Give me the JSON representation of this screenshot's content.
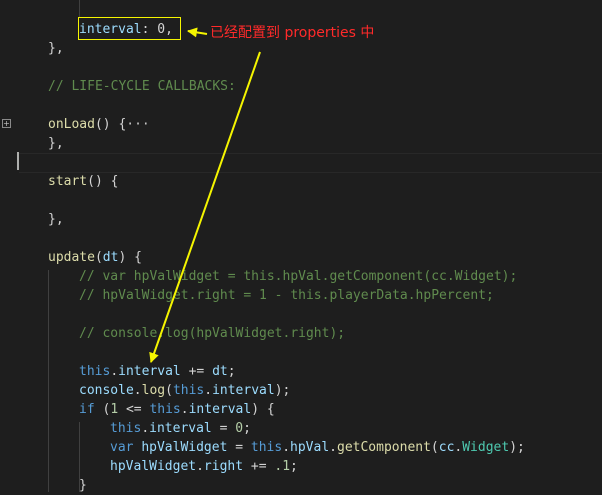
{
  "annotation": {
    "text": "已经配置到 properties 中",
    "color": "#ff2a2a",
    "arrow_color": "#f5f500"
  },
  "code": {
    "l_interval_name": "interval",
    "l_interval_rest": ": 0,",
    "l_close1": "},",
    "l_lifecycle": "// LIFE-CYCLE CALLBACKS:",
    "l_onload_name": "onLoad",
    "l_onload_rest": "() {",
    "l_onload_ellipsis": "···",
    "l_close2": "},",
    "l_start_name": "start",
    "l_start_rest": "() {",
    "l_close3": "},",
    "l_update_name": "update",
    "l_update_paren_open": "(",
    "l_update_param": "dt",
    "l_update_rest": ") {",
    "l_c1": "// var hpValWidget = this.hpVal.getComponent(cc.Widget);",
    "l_c2": "// hpValWidget.right = 1 - this.playerData.hpPercent;",
    "l_c3": "// console.log(hpValWidget.right);",
    "l_a_this": "this",
    "l_a_dot": ".",
    "l_a_prop": "interval",
    "l_a_op": " += ",
    "l_a_var": "dt",
    "l_a_end": ";",
    "l_b_console": "console",
    "l_b_dot": ".",
    "l_b_log": "log",
    "l_b_paren": "(",
    "l_b_this": "this",
    "l_b_dot2": ".",
    "l_b_prop": "interval",
    "l_b_end": ");",
    "l_if_kw": "if",
    "l_if_open": " (",
    "l_if_num": "1",
    "l_if_op": " <= ",
    "l_if_this": "this",
    "l_if_dot": ".",
    "l_if_prop": "interval",
    "l_if_end": ") {",
    "l_r_this": "this",
    "l_r_dot": ".",
    "l_r_prop": "interval",
    "l_r_op": " = ",
    "l_r_num": "0",
    "l_r_end": ";",
    "l_v_kw": "var",
    "l_v_name": "hpValWidget",
    "l_v_op": " = ",
    "l_v_this": "this",
    "l_v_dot": ".",
    "l_v_prop": "hpVal",
    "l_v_dot2": ".",
    "l_v_fn": "getComponent",
    "l_v_paren": "(",
    "l_v_cc": "cc",
    "l_v_dot3": ".",
    "l_v_cls": "Widget",
    "l_v_end": ");",
    "l_w_name": "hpValWidget",
    "l_w_dot": ".",
    "l_w_prop": "right",
    "l_w_op": " += ",
    "l_w_num": ".1",
    "l_w_end": ";",
    "l_last": "}"
  }
}
